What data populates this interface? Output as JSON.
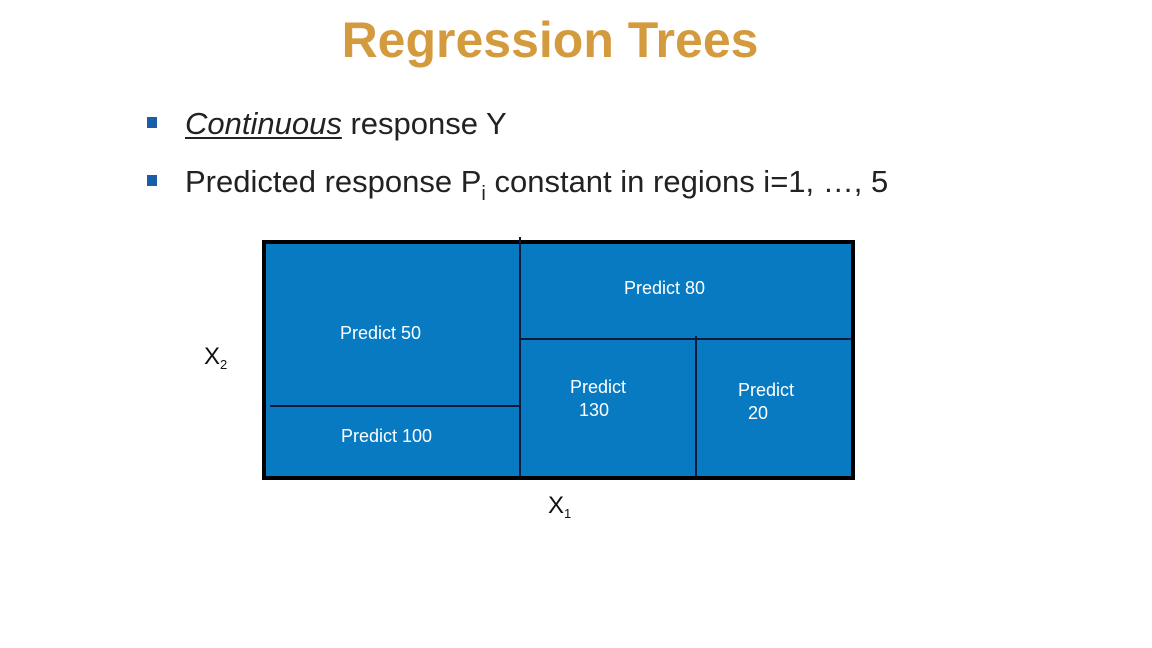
{
  "slide": {
    "title": "Regression Trees",
    "bullets": [
      {
        "emphasis": "Continuous",
        "text": " response Y"
      },
      {
        "pre": "Predicted response P",
        "subscript": "i",
        "post": " constant in regions i=1, …, 5"
      }
    ]
  },
  "diagram": {
    "colors": {
      "region_fill": "#077ac2",
      "border": "#000000",
      "title": "#d49b3e",
      "bullet": "#1b5ea8"
    },
    "axes": {
      "x": {
        "base": "X",
        "sub": "1"
      },
      "y": {
        "base": "X",
        "sub": "2"
      }
    },
    "regions": [
      {
        "id": "top-left",
        "line1": "Predict 50",
        "line2": ""
      },
      {
        "id": "bottom-left",
        "line1": "Predict 100",
        "line2": ""
      },
      {
        "id": "top-right",
        "line1": "Predict 80",
        "line2": ""
      },
      {
        "id": "bottom-middle",
        "line1": "Predict",
        "line2": "130"
      },
      {
        "id": "bottom-right",
        "line1": "Predict",
        "line2": "20"
      }
    ]
  }
}
